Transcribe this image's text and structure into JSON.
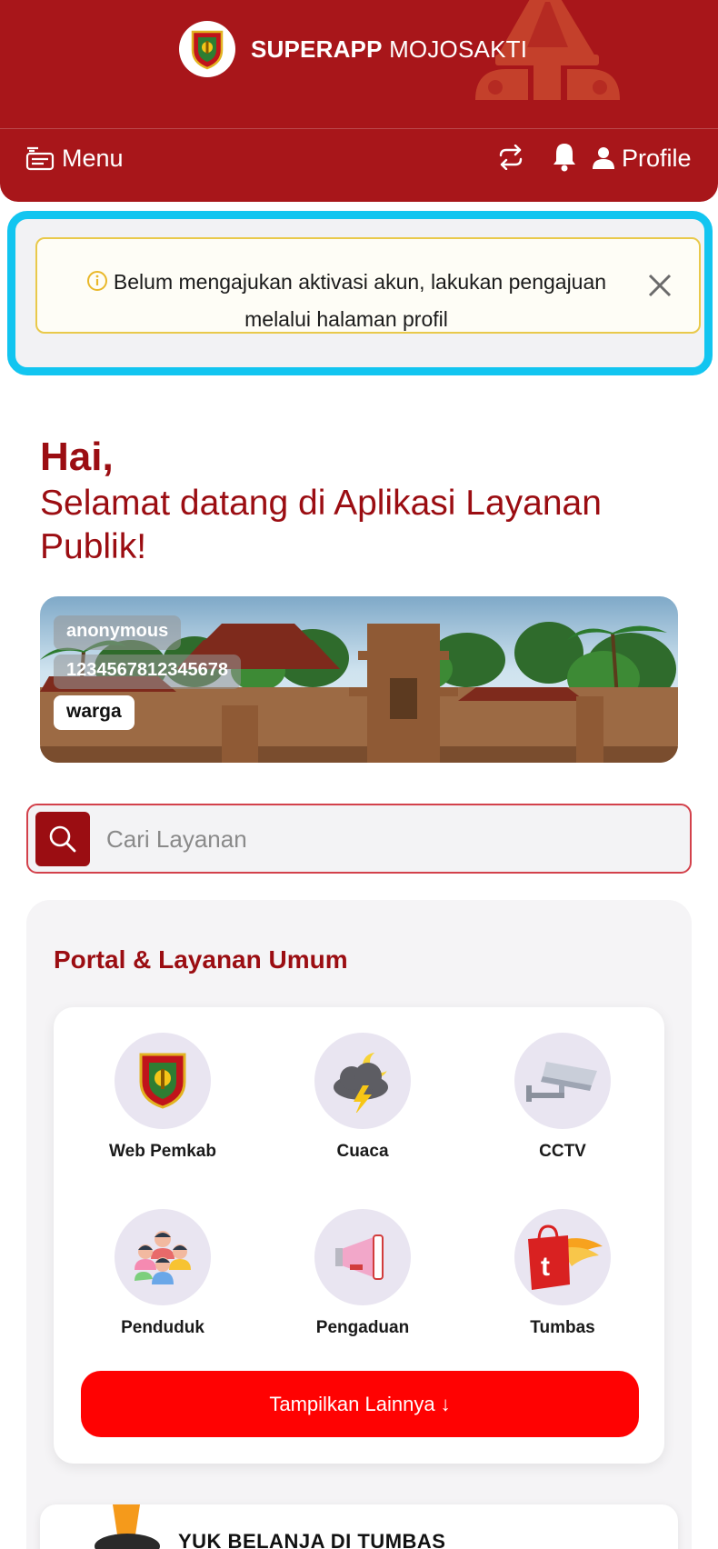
{
  "header": {
    "app_name_bold": "SUPERAPP",
    "app_name_regular": "MOJOSAKTI",
    "menu_label": "Menu",
    "profile_label": "Profile"
  },
  "alert": {
    "message": "Belum mengajukan aktivasi akun, lakukan pengajuan melalui halaman profil"
  },
  "greeting": {
    "hai": "Hai,",
    "welcome": "Selamat datang di Aplikasi Layanan Publik!"
  },
  "user_card": {
    "name": "anonymous",
    "nik": "1234567812345678",
    "role": "warga"
  },
  "search": {
    "placeholder": "Cari Layanan"
  },
  "portal": {
    "title": "Portal & Layanan Umum",
    "services": [
      {
        "label": "Web Pemkab",
        "icon": "government-emblem-icon"
      },
      {
        "label": "Cuaca",
        "icon": "weather-icon"
      },
      {
        "label": "CCTV",
        "icon": "cctv-camera-icon"
      },
      {
        "label": "Penduduk",
        "icon": "people-group-icon"
      },
      {
        "label": "Pengaduan",
        "icon": "megaphone-icon"
      },
      {
        "label": "Tumbas",
        "icon": "shopping-bag-icon"
      }
    ],
    "more_button": "Tampilkan Lainnya ↓"
  },
  "promo": {
    "title": "YUK BELANJA DI TUMBAS"
  },
  "colors": {
    "primary": "#a8161a",
    "accent_red": "#ff0202",
    "title_red": "#9b0d12",
    "highlight_border": "#12c5f0"
  }
}
